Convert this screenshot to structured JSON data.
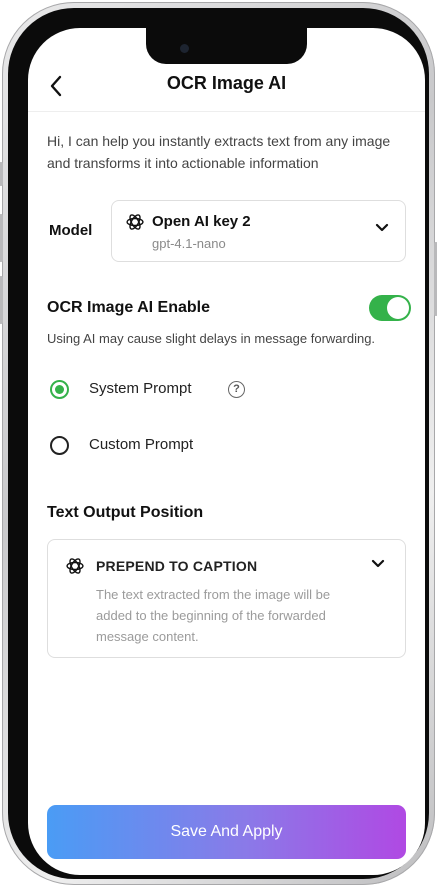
{
  "header": {
    "title": "OCR Image AI",
    "back_icon": "chevron-left-icon"
  },
  "intro_text": "Hi, I can help you  instantly extracts text from any image and transforms it into actionable information",
  "model": {
    "label": "Model",
    "name": "Open AI key 2",
    "version": "gpt-4.1-nano",
    "icon": "openai-icon"
  },
  "ocr_enable": {
    "label": "OCR Image AI Enable",
    "enabled": true,
    "toggle_color": "#34b24a",
    "warning": "Using AI may cause slight delays in message forwarding."
  },
  "prompt_options": [
    {
      "label": "System Prompt",
      "selected": true,
      "has_help": true,
      "help_glyph": "?"
    },
    {
      "label": "Custom Prompt",
      "selected": false,
      "has_help": false
    }
  ],
  "output_position": {
    "label": "Text Output Position",
    "value": "PREPEND TO CAPTION",
    "description": "The text extracted from the image will be added to the beginning of the forwarded message content."
  },
  "save_button": {
    "label": "Save And Apply",
    "gradient_start": "#4a9cf5",
    "gradient_end": "#b049e3"
  }
}
